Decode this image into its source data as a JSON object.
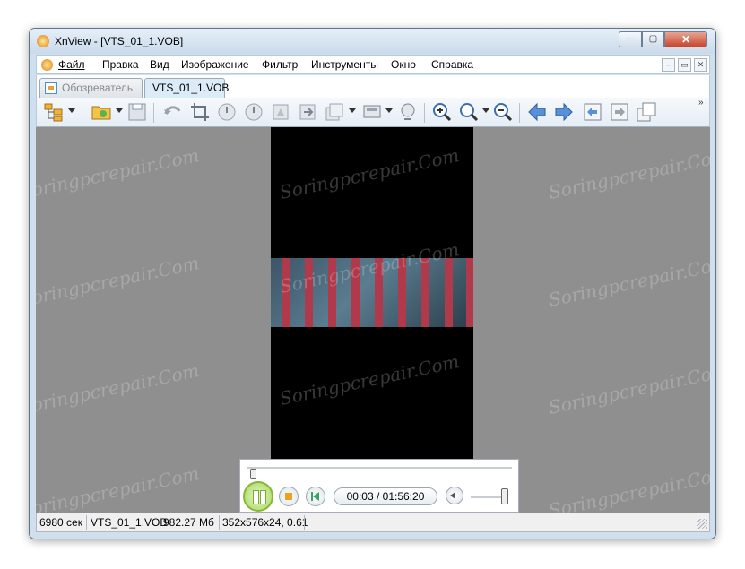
{
  "window": {
    "title": "XnView - [VTS_01_1.VOB]",
    "min_glyph": "—",
    "max_glyph": "▢",
    "close_glyph": "✕"
  },
  "menu": {
    "items": [
      "Файл",
      "Правка",
      "Вид",
      "Изображение",
      "Фильтр",
      "Инструменты",
      "Окно",
      "Справка"
    ],
    "mdi": {
      "min": "–",
      "restore": "▭",
      "close": "✕"
    }
  },
  "tabs": [
    {
      "label": "Обозреватель",
      "active": false
    },
    {
      "label": "VTS_01_1.VOB",
      "active": true
    }
  ],
  "toolbar": {
    "buttons": [
      "browser-icon",
      "open-folder-icon",
      "save-icon",
      "undo-icon",
      "crop-icon",
      "rotate-left-icon",
      "rotate-right-icon",
      "flip-icon",
      "export-icon",
      "batch-convert-icon",
      "screen-capture-icon",
      "print-icon",
      "zoom-in-icon",
      "zoom-1-1-icon",
      "zoom-out-icon",
      "arrow-left-icon",
      "arrow-right-icon",
      "prev-image-icon",
      "next-image-icon",
      "multi-page-icon"
    ],
    "overflow": "»"
  },
  "player": {
    "time": "00:03 / 01:56:20",
    "seek_fraction": 0.0,
    "volume_fraction": 0.95
  },
  "watermark": "Soringpcrepair.Com",
  "status": {
    "seconds": "6980 сек",
    "file": "VTS_01_1.VOB",
    "size": "982.27 Мб",
    "info": "352x576x24, 0.61"
  },
  "colors": {
    "viewer_bg": "#8f8f8f",
    "accent": "#4c8fd0",
    "play_green": "#a7d75b"
  }
}
